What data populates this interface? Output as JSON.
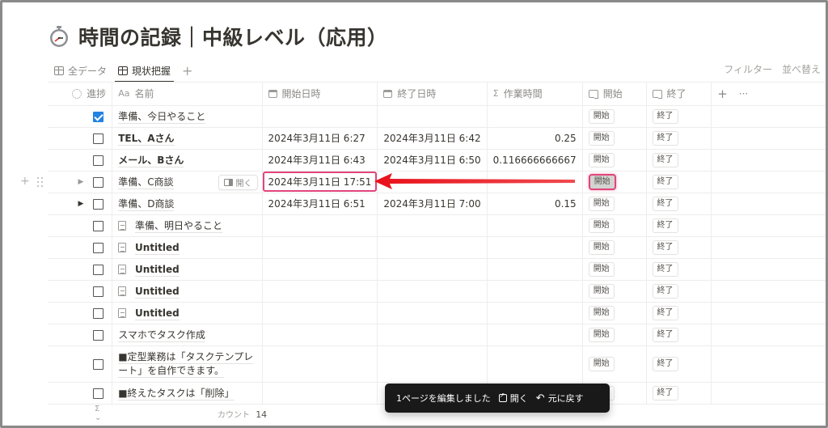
{
  "page": {
    "title": "時間の記録｜中級レベル（応用）",
    "title_icon": "stopwatch-icon"
  },
  "tabs": [
    {
      "label": "全データ",
      "icon": "table-icon",
      "active": false
    },
    {
      "label": "現状把握",
      "icon": "table-icon",
      "active": true
    }
  ],
  "tab_add": "+",
  "toolbar": {
    "filter": "フィルター",
    "sort": "並べ替え"
  },
  "columns": {
    "progress": "進捗",
    "name_prefix": "Aa",
    "name": "名前",
    "start_datetime": "開始日時",
    "end_datetime": "終了日時",
    "sigma": "Σ",
    "work_time": "作業時間",
    "start_button": "開始",
    "end_button": "終了",
    "add": "+",
    "more": "···"
  },
  "rows": [
    {
      "checked": true,
      "name": "準備、今日やること",
      "start": "",
      "end": "",
      "hours": "",
      "start_btn": "開始",
      "end_btn": "終了"
    },
    {
      "checked": false,
      "name": "TEL、Aさん",
      "start": "2024年3月11日 6:27",
      "end": "2024年3月11日 6:42",
      "hours": "0.25",
      "start_btn": "開始",
      "end_btn": "終了"
    },
    {
      "checked": false,
      "name": "メール、Bさん",
      "start": "2024年3月11日 6:43",
      "end": "2024年3月11日 6:50",
      "hours": "0.116666666667",
      "start_btn": "開始",
      "end_btn": "終了"
    },
    {
      "checked": false,
      "name": "準備、C商談",
      "start": "2024年3月11日 17:51",
      "end": "",
      "hours": "",
      "start_btn": "開始",
      "end_btn": "終了",
      "open_label": "開く"
    },
    {
      "checked": false,
      "name": "準備、D商談",
      "start": "2024年3月11日 6:51",
      "end": "2024年3月11日 7:00",
      "hours": "0.15",
      "start_btn": "開始",
      "end_btn": "終了"
    },
    {
      "checked": false,
      "name": "準備、明日やること",
      "start": "",
      "end": "",
      "hours": "",
      "start_btn": "開始",
      "end_btn": "終了"
    },
    {
      "checked": false,
      "name": "Untitled",
      "start": "",
      "end": "",
      "hours": "",
      "start_btn": "開始",
      "end_btn": "終了"
    },
    {
      "checked": false,
      "name": "Untitled",
      "start": "",
      "end": "",
      "hours": "",
      "start_btn": "開始",
      "end_btn": "終了"
    },
    {
      "checked": false,
      "name": "Untitled",
      "start": "",
      "end": "",
      "hours": "",
      "start_btn": "開始",
      "end_btn": "終了"
    },
    {
      "checked": false,
      "name": "Untitled",
      "start": "",
      "end": "",
      "hours": "",
      "start_btn": "開始",
      "end_btn": "終了"
    },
    {
      "checked": false,
      "name": "スマホでタスク作成",
      "start": "",
      "end": "",
      "hours": "",
      "start_btn": "開始",
      "end_btn": "終了"
    },
    {
      "checked": false,
      "name": "■定型業務は「タスクテンプレート」を自作できます。",
      "start": "",
      "end": "",
      "hours": "",
      "start_btn": "開始",
      "end_btn": "終了"
    },
    {
      "checked": false,
      "name": "■終えたタスクは「削除」",
      "start": "",
      "end": "",
      "hours": "",
      "start_btn": "開始",
      "end_btn": "終了"
    }
  ],
  "footer": {
    "sigma": "Σ ⌄",
    "count_label": "カウント",
    "count_value": "14"
  },
  "toast": {
    "message": "1ページを編集しました",
    "open": "開く",
    "undo": "元に戻す"
  },
  "annotation": {
    "highlight_color": "#e0457b",
    "arrow_color": "#e8101a"
  },
  "colors": {
    "checkbox_checked": "#2383e2",
    "toast_bg": "#191919"
  }
}
